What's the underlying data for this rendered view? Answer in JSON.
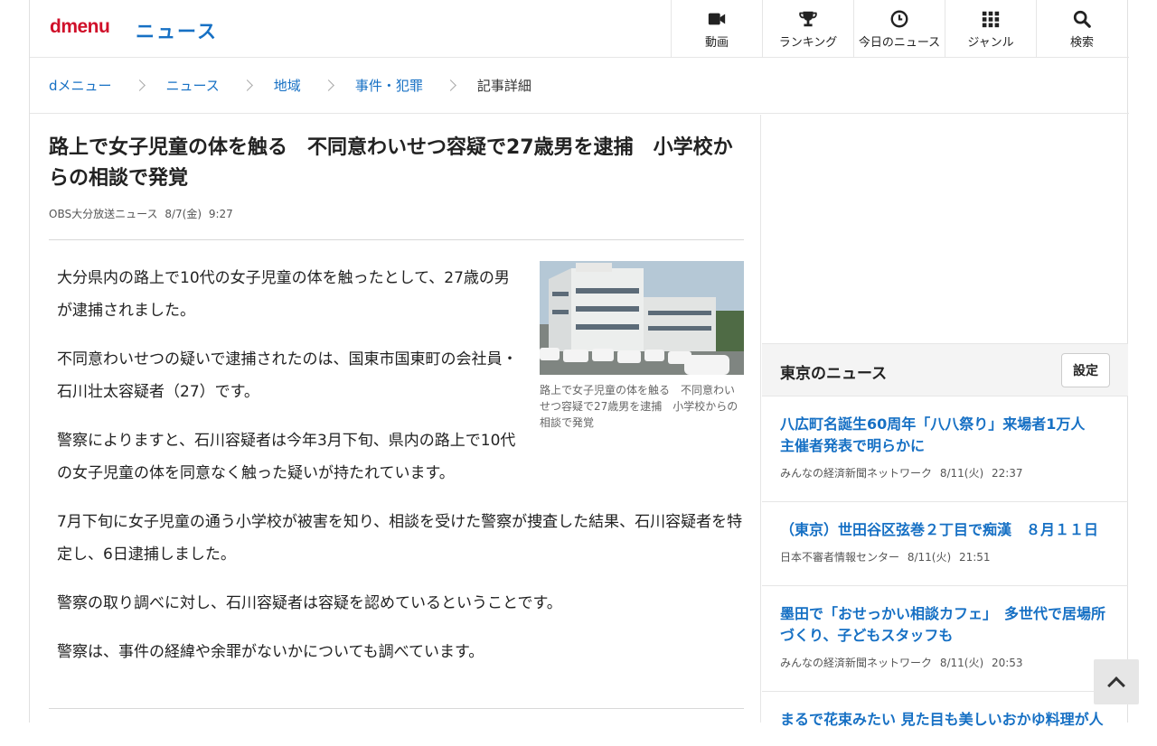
{
  "header": {
    "logo": "dmenu",
    "section_title": "ニュース",
    "nav": [
      {
        "label": "動画",
        "icon": "video-camera-icon"
      },
      {
        "label": "ランキング",
        "icon": "trophy-icon"
      },
      {
        "label": "今日のニュース",
        "icon": "clock-icon"
      },
      {
        "label": "ジャンル",
        "icon": "grid-icon"
      },
      {
        "label": "検索",
        "icon": "search-icon"
      }
    ]
  },
  "breadcrumb": [
    "dメニュー",
    "ニュース",
    "地域",
    "事件・犯罪",
    "記事詳細"
  ],
  "article": {
    "title": "路上で女子児童の体を触る　不同意わいせつ容疑で27歳男を逮捕　小学校からの相談で発覚",
    "source": "OBS大分放送ニュース",
    "date": "8/7(金)",
    "time": "9:27",
    "paragraphs": [
      "大分県内の路上で10代の女子児童の体を触ったとして、27歳の男が逮捕されました。",
      "不同意わいせつの疑いで逮捕されたのは、国東市国東町の会社員・石川壮太容疑者（27）です。",
      "警察によりますと、石川容疑者は今年3月下旬、県内の路上で10代の女子児童の体を同意なく触った疑いが持たれています。",
      "7月下旬に女子児童の通う小学校が被害を知り、相談を受けた警察が捜査した結果、石川容疑者を特定し、6日逮捕しました。",
      "警察の取り調べに対し、石川容疑者は容疑を認めているということです。",
      "警察は、事件の経緯や余罪がないかについても調べています。"
    ],
    "image_caption": "路上で女子児童の体を触る　不同意わいせつ容疑で27歳男を逮捕　小学校からの相談で発覚"
  },
  "sidebar": {
    "title": "東京のニュース",
    "settings_label": "設定",
    "items": [
      {
        "title": "八広町名誕生60周年「八八祭り」来場者1万人　主催者発表で明らかに",
        "source": "みんなの経済新聞ネットワーク",
        "date": "8/11(火)",
        "time": "22:37"
      },
      {
        "title": "（東京）世田谷区弦巻２丁目で痴漢　８月１１日",
        "source": "日本不審者情報センター",
        "date": "8/11(火)",
        "time": "21:51"
      },
      {
        "title": "墨田で「おせっかい相談カフェ」　多世代で居場所づくり、子どもスタッフも",
        "source": "みんなの経済新聞ネットワーク",
        "date": "8/11(火)",
        "time": "20:53"
      },
      {
        "title": "まるで花束みたい 見た目も美しいおかゆ料理が人",
        "source": "",
        "date": "",
        "time": ""
      }
    ]
  },
  "colors": {
    "brand_red": "#d0102a",
    "link_blue": "#1670c4"
  }
}
